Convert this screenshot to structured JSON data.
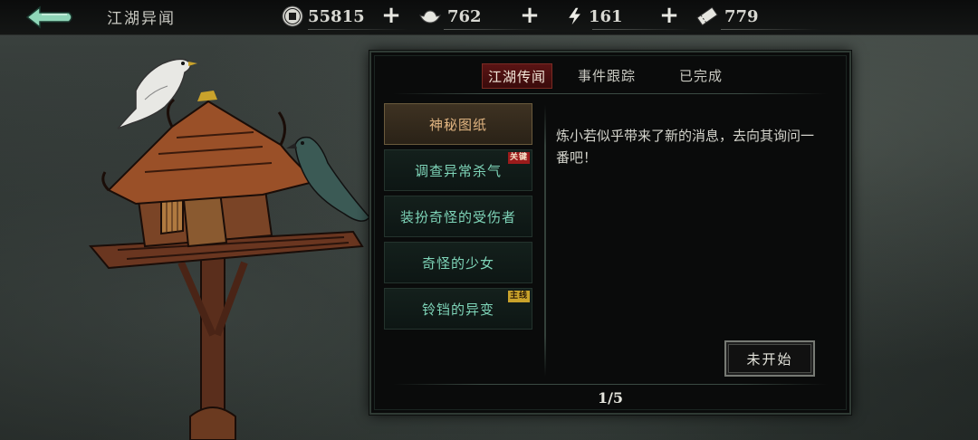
{
  "header": {
    "title": "江湖异闻",
    "resources": [
      {
        "icon": "coin-icon",
        "value": "55815"
      },
      {
        "icon": "silver-ingot-icon",
        "value": "762"
      },
      {
        "icon": "lightning-icon",
        "value": "161"
      },
      {
        "icon": "ticket-icon",
        "value": "779"
      }
    ],
    "plus_label": "+"
  },
  "tabs": [
    {
      "label": "江湖传闻",
      "active": true
    },
    {
      "label": "事件跟踪",
      "active": false
    },
    {
      "label": "已完成",
      "active": false
    }
  ],
  "events": [
    {
      "label": "神秘图纸",
      "selected": true,
      "badge": ""
    },
    {
      "label": "调查异常杀气",
      "selected": false,
      "badge": "关键"
    },
    {
      "label": "装扮奇怪的受伤者",
      "selected": false,
      "badge": ""
    },
    {
      "label": "奇怪的少女",
      "selected": false,
      "badge": ""
    },
    {
      "label": "铃铛的异变",
      "selected": false,
      "badge": "主线"
    }
  ],
  "detail": {
    "description": "炼小若似乎带来了新的消息，去向其询问一番吧！",
    "action_label": "未开始"
  },
  "pager": "1/5",
  "colors": {
    "active_tab": "#5a1414",
    "item_text": "#7ed4b8",
    "selected_text": "#e0b480",
    "badge_red": "#9b1b1b",
    "badge_gold": "#c9a22b"
  }
}
